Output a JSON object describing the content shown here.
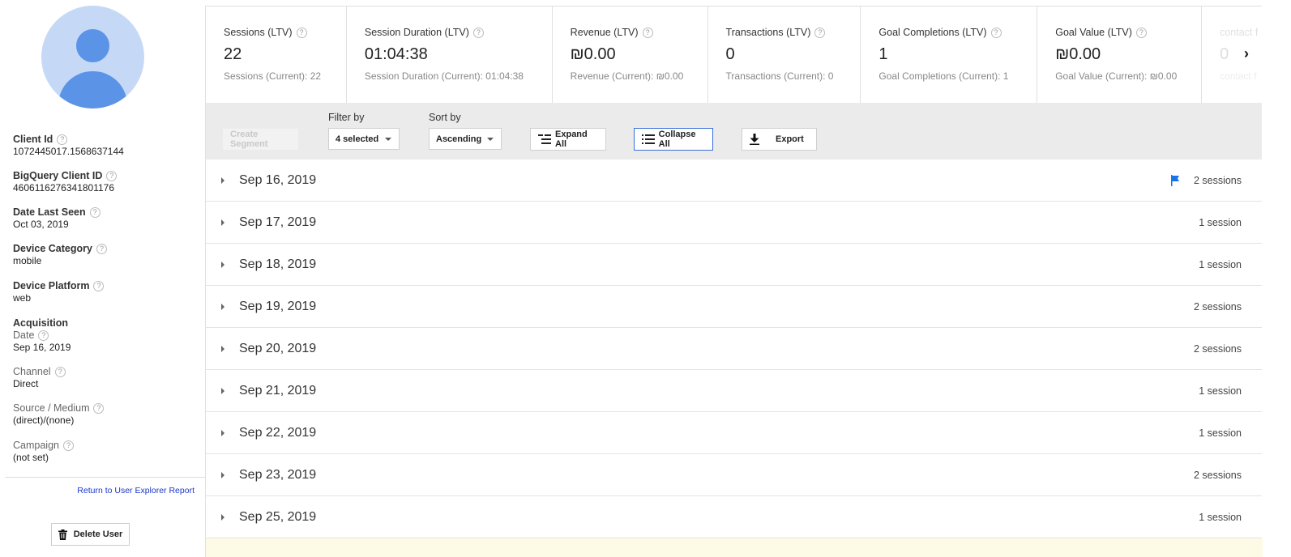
{
  "sidebar": {
    "fields": [
      {
        "label": "Client Id",
        "value": "1072445017.1568637144"
      },
      {
        "label": "BigQuery Client ID",
        "value": "4606116276341801176"
      },
      {
        "label": "Date Last Seen",
        "value": "Oct 03, 2019"
      },
      {
        "label": "Device Category",
        "value": "mobile"
      },
      {
        "label": "Device Platform",
        "value": "web"
      }
    ],
    "acquisition": {
      "heading": "Acquisition",
      "date_label": "Date",
      "date_value": "Sep 16, 2019",
      "channel_label": "Channel",
      "channel_value": "Direct",
      "source_label": "Source / Medium",
      "source_value": "(direct)/(none)",
      "campaign_label": "Campaign",
      "campaign_value": "(not set)"
    },
    "return_link": "Return to User Explorer Report",
    "delete_button": "Delete User",
    "help_glyph": "?"
  },
  "metrics": [
    {
      "label": "Sessions (LTV)",
      "value": "22",
      "sub": "Sessions (Current): 22"
    },
    {
      "label": "Session Duration (LTV)",
      "value": "01:04:38",
      "sub": "Session Duration (Current): 01:04:38"
    },
    {
      "label": "Revenue (LTV)",
      "value": "₪0.00",
      "sub": "Revenue (Current): ₪0.00"
    },
    {
      "label": "Transactions (LTV)",
      "value": "0",
      "sub": "Transactions (Current): 0"
    },
    {
      "label": "Goal Completions (LTV)",
      "value": "1",
      "sub": "Goal Completions (Current): 1"
    },
    {
      "label": "Goal Value (LTV)",
      "value": "₪0.00",
      "sub": "Goal Value (Current): ₪0.00"
    },
    {
      "label": "contact f",
      "value": "0",
      "sub": "contact f"
    }
  ],
  "toolbar": {
    "create_segment": "Create Segment",
    "filter_label": "Filter by",
    "filter_value": "4 selected",
    "sort_label": "Sort by",
    "sort_value": "Ascending",
    "expand_all": "Expand All",
    "collapse_all": "Collapse All",
    "export": "Export"
  },
  "rows": [
    {
      "date": "Sep 16, 2019",
      "sessions": "2 sessions",
      "flag": true
    },
    {
      "date": "Sep 17, 2019",
      "sessions": "1 session"
    },
    {
      "date": "Sep 18, 2019",
      "sessions": "1 session"
    },
    {
      "date": "Sep 19, 2019",
      "sessions": "2 sessions"
    },
    {
      "date": "Sep 20, 2019",
      "sessions": "2 sessions"
    },
    {
      "date": "Sep 21, 2019",
      "sessions": "1 session"
    },
    {
      "date": "Sep 22, 2019",
      "sessions": "1 session"
    },
    {
      "date": "Sep 23, 2019",
      "sessions": "2 sessions"
    },
    {
      "date": "Sep 25, 2019",
      "sessions": "1 session"
    }
  ],
  "colors": {
    "accent": "#3a6fd8",
    "flag": "#1a73e8",
    "avatar_bg": "#c5d9f7",
    "avatar_fg": "#5b93e6",
    "link": "#1a37cc"
  }
}
